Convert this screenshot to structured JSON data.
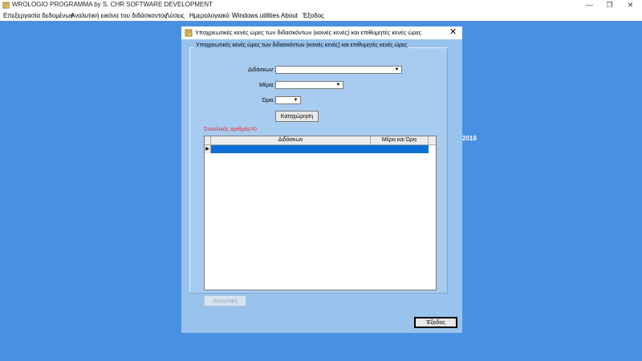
{
  "app": {
    "title": "WROLOGIO PROGRAMMA by S. CHR SOFTWARE DEVELOPMENT",
    "window_controls": {
      "minimize": "—",
      "restore": "❐",
      "close": "✕"
    }
  },
  "menu": {
    "items": [
      "Επεξεργασία δεδομένων",
      "Αναλυτική εικόνα του διδάσκοντος",
      "Λύσεις",
      "Ημερολογιακό",
      "Windows utilities",
      "About",
      "Έξοδος"
    ]
  },
  "desktop": {
    "year_text": "2018"
  },
  "dialog": {
    "title": "Υποχρεωτικές κενές ώρες των διδασκόντων (κοινές κενές) και επιθυμητές κενές ώρες",
    "close_glyph": "✕",
    "group_label": "Υποχρεωτικές κενές ώρες των διδασκόντων (κοινές κενές) και επιθυμητές κενές ώρες",
    "fields": {
      "teacher_label": "Διδάσκων:",
      "teacher_value": "",
      "day_label": "Μέρα:",
      "day_value": "",
      "hour_label": "Ώρα:",
      "hour_value": ""
    },
    "register_button": "Καταχώρηση",
    "total_count_label": "Συνολικός αριθμός=0",
    "grid": {
      "columns": [
        "Διδάσκων",
        "Μέρα και Ώρα"
      ],
      "rows": [
        {
          "teacher": "",
          "day_hour": ""
        }
      ],
      "row_indicator": "▶"
    },
    "delete_button": "Διαγραφή",
    "exit_button": "Έξοδος"
  },
  "colors": {
    "desktop": "#4a90e2",
    "dialog": "#99c2ec",
    "selection": "#0a6fd6",
    "count_text": "#e03030"
  }
}
